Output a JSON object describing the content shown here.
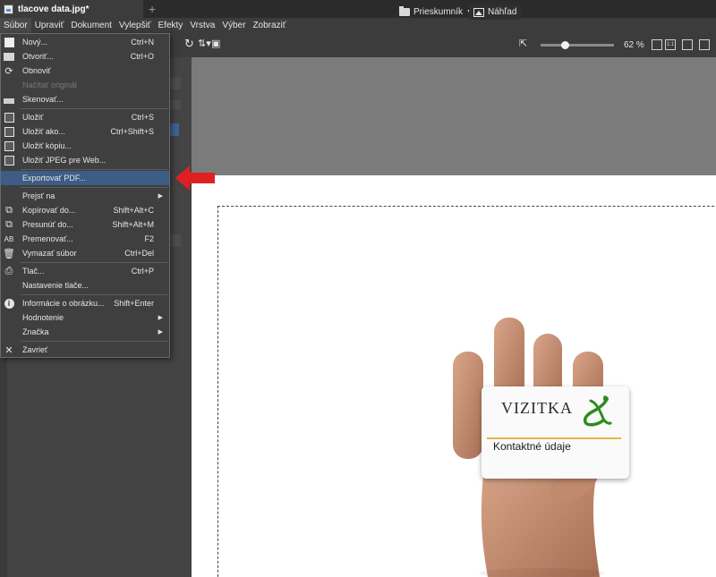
{
  "tab": {
    "title": "tlacove data.jpg*",
    "add": "+"
  },
  "menubar": [
    "Súbor",
    "Upraviť",
    "Dokument",
    "Vylepšiť",
    "Efekty",
    "Vrstva",
    "Výber",
    "Zobraziť"
  ],
  "toolbar": {
    "explorer_label": "Prieskumník",
    "preview_label": "Náhľad",
    "zoom": "62 %",
    "fit_btn": "1:1"
  },
  "card": {
    "title": "VIZITKA",
    "contact": "Kontaktné údaje",
    "accent": "#e2b84a",
    "logo_color": "#2e8b1e"
  },
  "menu": [
    {
      "label": "Nový...",
      "shortcut": "Ctrl+N",
      "icon": "new-file-icon"
    },
    {
      "label": "Otvoriť...",
      "shortcut": "Ctrl+O",
      "icon": "open-folder-icon"
    },
    {
      "label": "Obnoviť",
      "shortcut": "",
      "icon": "refresh-icon"
    },
    {
      "label": "Načítať originál",
      "shortcut": "",
      "icon": "",
      "disabled": true
    },
    {
      "label": "Skenovať...",
      "shortcut": "",
      "icon": "scanner-icon"
    },
    {
      "label": "Uložiť",
      "shortcut": "Ctrl+S",
      "icon": "save-icon"
    },
    {
      "label": "Uložiť ako...",
      "shortcut": "Ctrl+Shift+S",
      "icon": "save-as-icon"
    },
    {
      "label": "Uložiť kópiu...",
      "shortcut": "",
      "icon": "save-copy-icon"
    },
    {
      "label": "Uložiť JPEG pre Web...",
      "shortcut": "",
      "icon": "save-web-icon"
    },
    {
      "label": "Exportovať PDF...",
      "shortcut": "",
      "icon": "",
      "highlighted": true
    },
    {
      "label": "Prejsť na",
      "shortcut": "",
      "icon": "",
      "submenu": true
    },
    {
      "label": "Kopírovať do...",
      "shortcut": "Shift+Alt+C",
      "icon": "copy-to-icon"
    },
    {
      "label": "Presunúť do...",
      "shortcut": "Shift+Alt+M",
      "icon": "move-to-icon"
    },
    {
      "label": "Premenovať...",
      "shortcut": "F2",
      "icon": "rename-icon"
    },
    {
      "label": "Vymazať súbor",
      "shortcut": "Ctrl+Del",
      "icon": "delete-icon"
    },
    {
      "label": "Tlač...",
      "shortcut": "Ctrl+P",
      "icon": "print-icon"
    },
    {
      "label": "Nastavenie tlače...",
      "shortcut": "",
      "icon": ""
    },
    {
      "label": "Informácie o obrázku...",
      "shortcut": "Shift+Enter",
      "icon": "info-icon"
    },
    {
      "label": "Hodnotenie",
      "shortcut": "",
      "icon": "",
      "submenu": true
    },
    {
      "label": "Značka",
      "shortcut": "",
      "icon": "",
      "submenu": true
    },
    {
      "label": "Zavrieť",
      "shortcut": "",
      "icon": "close-icon"
    }
  ]
}
